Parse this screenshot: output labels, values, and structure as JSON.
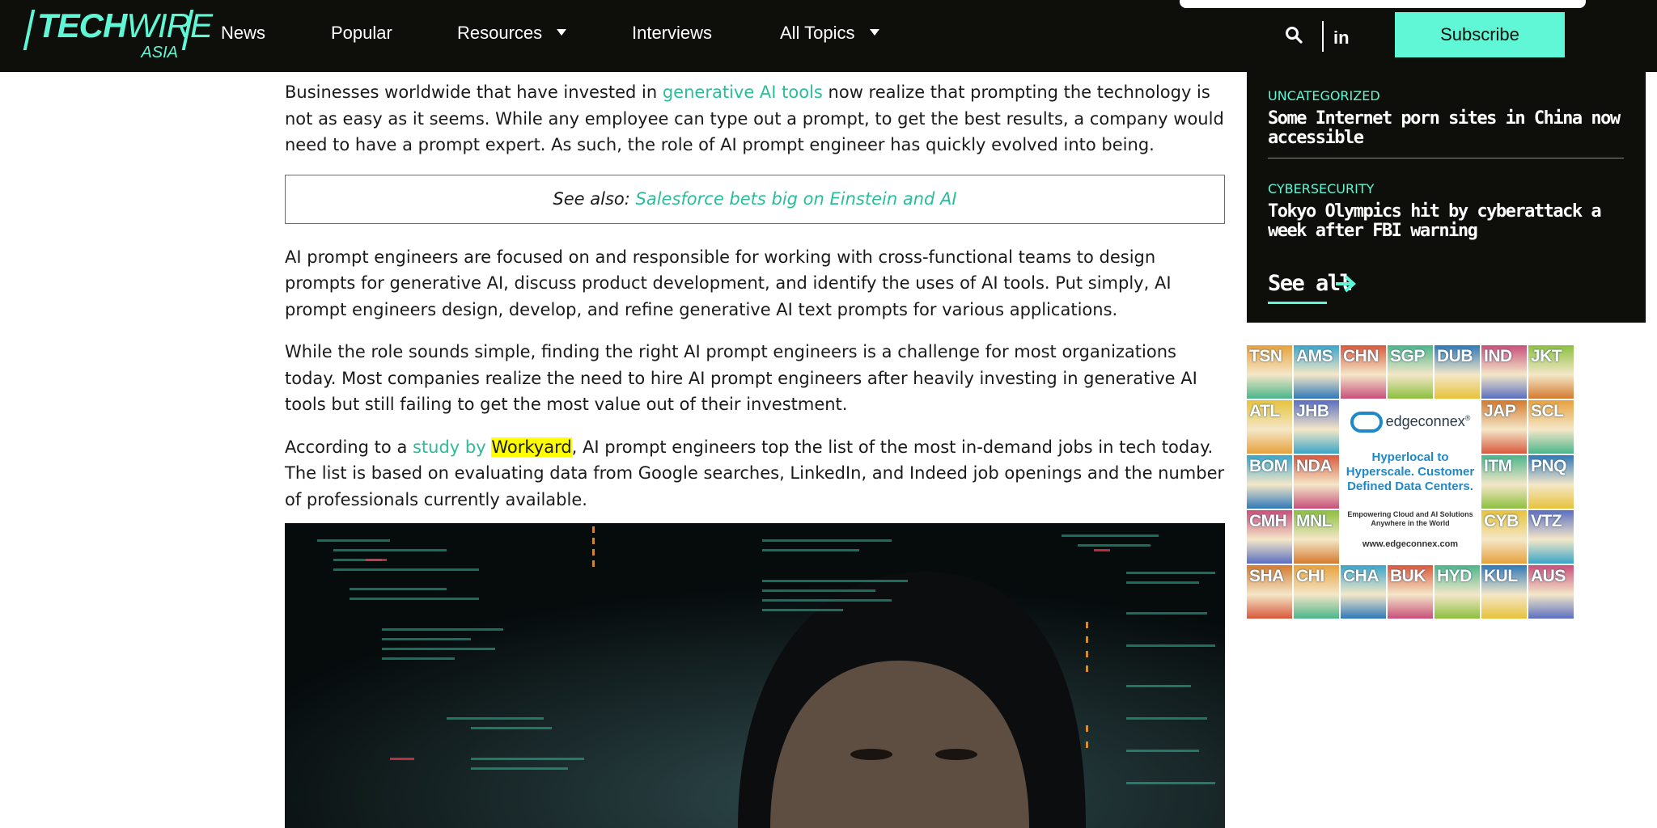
{
  "header": {
    "logo_main_bold": "TECH",
    "logo_main_light": "WIRE",
    "logo_sub": "ASIA",
    "nav": [
      {
        "label": "News"
      },
      {
        "label": "Popular"
      },
      {
        "label": "Resources",
        "dropdown": true
      },
      {
        "label": "Interviews"
      },
      {
        "label": "All Topics",
        "dropdown": true
      }
    ],
    "subscribe_label": "Subscribe",
    "icons": [
      "search-icon",
      "linkedin-icon"
    ],
    "linkedin_glyph": "in"
  },
  "article": {
    "p1_a": "Businesses worldwide that have invested in ",
    "p1_link": "generative AI tools",
    "p1_b": " now realize that prompting the technology is not as easy as it seems. While any employee can type out a prompt, to get the best results, a company would need to have a prompt expert. As such, the role of AI prompt engineer has quickly evolved into being.",
    "see_also_prefix": "See also: ",
    "see_also_link": "Salesforce bets big on Einstein and AI",
    "p2": "AI prompt engineers are focused on and responsible for working with cross-functional teams to design prompts for generative AI, discuss product development, and identify the uses of AI tools. Put simply, AI prompt engineers design, develop, and refine generative AI text prompts for various applications.",
    "p3": "While the role sounds simple, finding the right AI prompt engineers is a challenge for most organizations today. Most companies realize the need to hire AI prompt engineers after heavily investing in generative AI tools but still failing to get the most value out of their investment.",
    "p4_a": "According to a ",
    "p4_link": "study by ",
    "p4_highlight": "Workyard",
    "p4_b": ", AI prompt engineers top the list of the most in-demand jobs in tech today. The list is based on evaluating data from Google searches, LinkedIn, and Indeed job openings and the number of professionals currently available."
  },
  "sidebar": {
    "items": [
      {
        "category": "UNCATEGORIZED",
        "title": "Some Internet porn sites in China now accessible"
      },
      {
        "category": "CYBERSECURITY",
        "title": "Tokyo Olympics hit by cyberattack a week after FBI warning"
      }
    ],
    "see_all_label": "See all"
  },
  "ad": {
    "tiles": [
      "TSN",
      "AMS",
      "CHN",
      "SGP",
      "DUB",
      "IND",
      "JKT",
      "ATL",
      "JHB",
      "JAP",
      "SCL",
      "BOM",
      "NDA",
      "ITM",
      "PNQ",
      "CMH",
      "MNL",
      "CYB",
      "VTZ",
      "SHA",
      "CHI",
      "CHA",
      "BUK",
      "HYD",
      "KUL",
      "AUS"
    ],
    "brand": "edgeconnex",
    "brand_mark": "®",
    "headline": "Hyperlocal to Hyperscale. Customer Defined Data Centers.",
    "sub": "Empowering Cloud and AI Solutions Anywhere in the World",
    "url": "www.edgeconnex.com"
  },
  "colors": {
    "accent": "#5ff7d6",
    "link": "#2bbd9a",
    "nav_bg": "#0e0f0a",
    "highlight": "#ffff00"
  }
}
